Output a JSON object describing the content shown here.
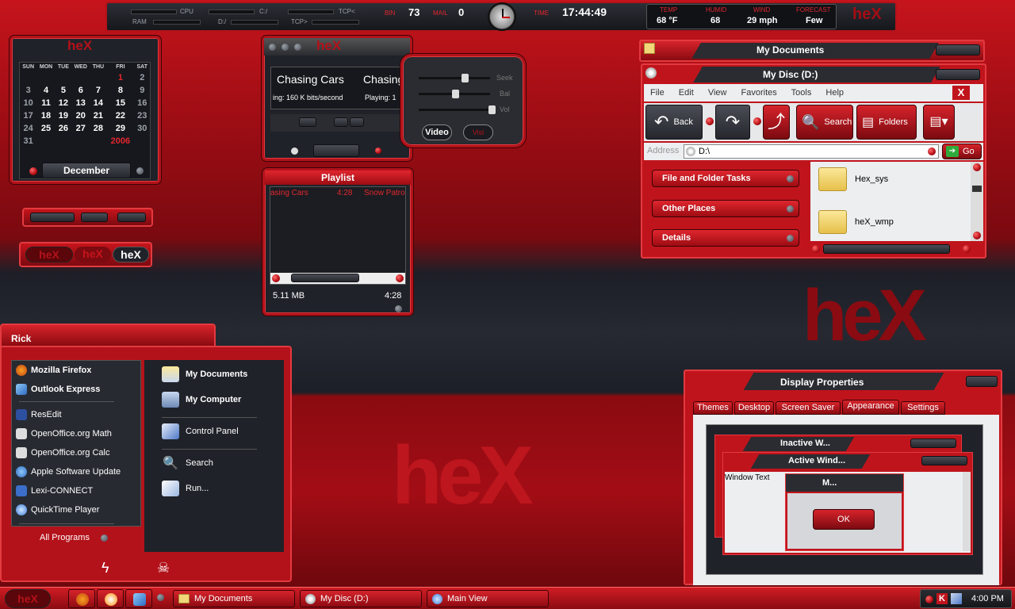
{
  "topbar": {
    "cpu_label": "CPU",
    "ram_label": "RAM",
    "c_label": "C:/",
    "d_label": "D:/",
    "tcp_in_label": "TCP<",
    "tcp_out_label": "TCP>",
    "bin_label": "BIN",
    "bin_value": "73",
    "mail_label": "MAIL",
    "mail_value": "0",
    "time_label": "TIME",
    "time_value": "17:44:49",
    "temp_label": "TEMP",
    "temp_value": "68 °F",
    "humid_label": "HUMID",
    "humid_value": "68",
    "wind_label": "WIND",
    "wind_value": "29 mph",
    "forecast_label": "FORECAST",
    "forecast_value": "Few",
    "logo": "heX"
  },
  "calendar": {
    "logo": "heX",
    "days": [
      "SUN",
      "MON",
      "TUE",
      "WED",
      "THU",
      "FRI",
      "SAT"
    ],
    "weeks": [
      [
        "",
        "",
        "",
        "",
        "",
        "1",
        "2"
      ],
      [
        "3",
        "4",
        "5",
        "6",
        "7",
        "8",
        "9"
      ],
      [
        "10",
        "11",
        "12",
        "13",
        "14",
        "15",
        "16"
      ],
      [
        "17",
        "18",
        "19",
        "20",
        "21",
        "22",
        "23"
      ],
      [
        "24",
        "25",
        "26",
        "27",
        "28",
        "29",
        "30"
      ],
      [
        "31",
        "",
        "",
        "",
        "",
        "2006",
        ""
      ]
    ],
    "month": "December"
  },
  "left_widgets": {
    "logo_a": "heX",
    "logo_b": "heX",
    "logo_c": "heX"
  },
  "player": {
    "logo": "heX",
    "title": "Chasing Cars",
    "title2": "Chasing",
    "bitrate": "ing: 160 K bits/second",
    "playing": "Playing: 1",
    "seek_label": "Seek",
    "bal_label": "Bal",
    "vol_label": "Vol",
    "video_button": "Video",
    "visual_button": "Visl"
  },
  "playlist": {
    "title": "Playlist",
    "track": "asing Cars",
    "track_time": "4:28",
    "track_artist": "Snow Patro",
    "size": "5.11 MB",
    "duration": "4:28"
  },
  "mydocs": {
    "title": "My Documents"
  },
  "mydisc": {
    "title": "My Disc (D:)",
    "menu": [
      "File",
      "Edit",
      "View",
      "Favorites",
      "Tools",
      "Help"
    ],
    "back": "Back",
    "search": "Search",
    "folders": "Folders",
    "address_label": "Address",
    "address_value": "D:\\",
    "go": "Go",
    "tasks": [
      "File and Folder Tasks",
      "Other Places",
      "Details"
    ],
    "files": [
      "Hex_sys",
      "heX_wmp"
    ]
  },
  "wallpaper": {
    "logo_top": "heX",
    "logo_center": "heX"
  },
  "startmenu": {
    "user": "Rick",
    "pinned": [
      "Mozilla Firefox",
      "Outlook Express"
    ],
    "recent": [
      "ResEdit",
      "OpenOffice.org Math",
      "OpenOffice.org Calc",
      "Apple Software Update",
      "Lexi-CONNECT",
      "QuickTime Player"
    ],
    "all_programs": "All Programs",
    "right": [
      "My Documents",
      "My Computer",
      "Control Panel",
      "Search",
      "Run..."
    ]
  },
  "dispprops": {
    "title": "Display Properties",
    "tabs": [
      "Themes",
      "Desktop",
      "Screen Saver",
      "Appearance",
      "Settings"
    ],
    "inactive_title": "Inactive W...",
    "active_title": "Active Wind...",
    "window_text": "Window Text",
    "msg_title": "M...",
    "ok": "OK"
  },
  "taskbar": {
    "start_logo": "heX",
    "tasks": [
      "My Documents",
      "My Disc (D:)",
      "Main View"
    ],
    "clock": "4:00 PM"
  },
  "colors": {
    "accent": "#c8141c",
    "dark": "#1f2229"
  }
}
